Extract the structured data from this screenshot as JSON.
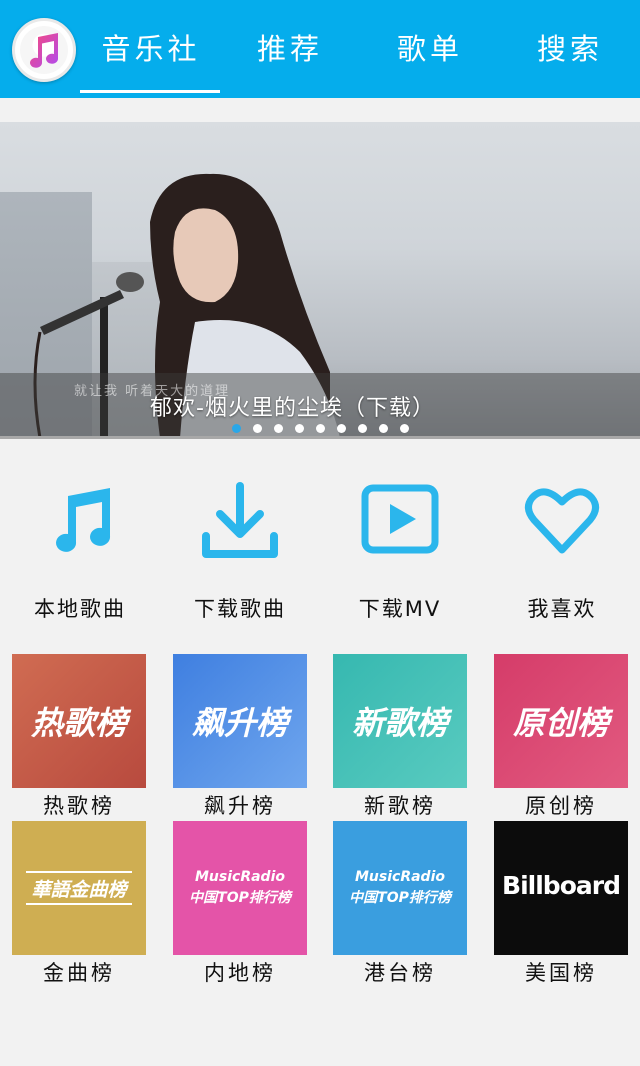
{
  "header": {
    "tabs": [
      {
        "label": "音乐社",
        "active": true
      },
      {
        "label": "推荐"
      },
      {
        "label": "歌单"
      },
      {
        "label": "搜索"
      }
    ],
    "accent_color": "#05adec"
  },
  "banner": {
    "lyric_overlay": "就让我 听着天大的道理",
    "title": "郁欢-烟火里的尘埃（下载）",
    "dots_total": 9,
    "active_dot": 1
  },
  "quick_actions": [
    {
      "label": "本地歌曲",
      "icon": "music-note-icon"
    },
    {
      "label": "下载歌曲",
      "icon": "download-icon"
    },
    {
      "label": "下载MV",
      "icon": "play-icon"
    },
    {
      "label": "我喜欢",
      "icon": "heart-icon"
    }
  ],
  "ranks": [
    {
      "label": "热歌榜",
      "tile_text": "热歌榜",
      "color": "#c85c47"
    },
    {
      "label": "飙升榜",
      "tile_text": "飙升榜",
      "color": "#4e86dc"
    },
    {
      "label": "新歌榜",
      "tile_text": "新歌榜",
      "color": "#3fbdb5"
    },
    {
      "label": "原创榜",
      "tile_text": "原创榜",
      "color": "#d2456f"
    },
    {
      "label": "金曲榜",
      "tile_text": "華語金曲榜",
      "color": "#cfae52"
    },
    {
      "label": "内地榜",
      "tile_text_top": "MusicRadio",
      "tile_text_bottom": "中国TOP排行榜",
      "color": "#e454a8"
    },
    {
      "label": "港台榜",
      "tile_text_top": "MusicRadio",
      "tile_text_bottom": "中国TOP排行榜",
      "color": "#3a9edf"
    },
    {
      "label": "美国榜",
      "tile_text": "Billboard",
      "color": "#0c0c0c"
    }
  ]
}
